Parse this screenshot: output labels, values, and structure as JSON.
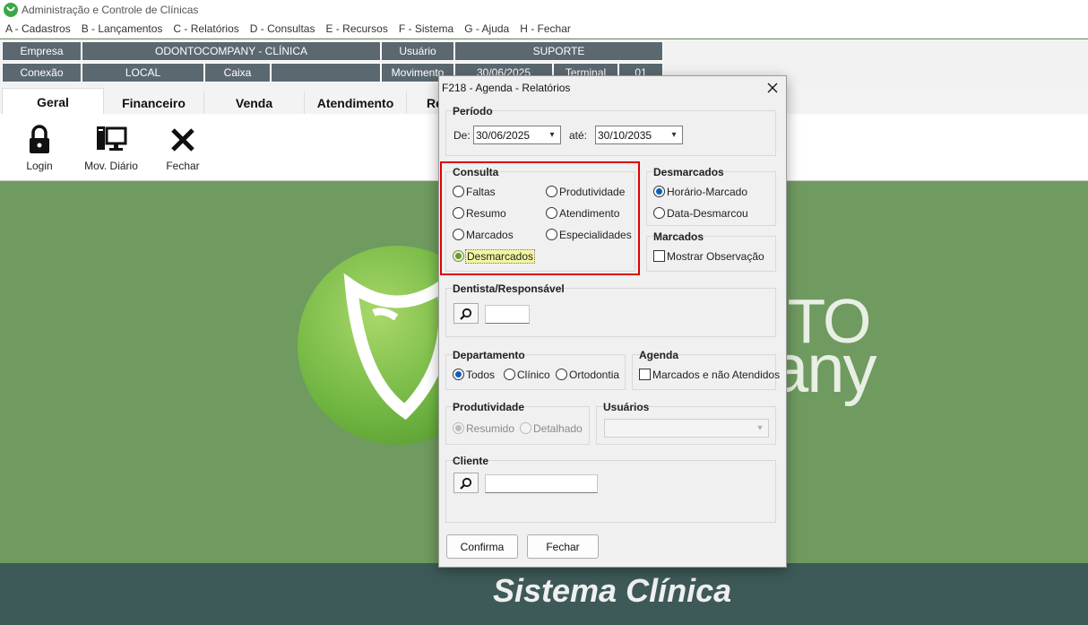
{
  "window": {
    "title": "Administração e Controle de Clínicas"
  },
  "menu": [
    "A - Cadastros",
    "B - Lançamentos",
    "C - Relatórios",
    "D - Consultas",
    "E - Recursos",
    "F - Sistema",
    "G - Ajuda",
    "H - Fechar"
  ],
  "info": {
    "empresa_label": "Empresa",
    "empresa_value": "ODONTOCOMPANY - CLÍNICA",
    "usuario_label": "Usuário",
    "usuario_value": "SUPORTE",
    "conexao_label": "Conexão",
    "conexao_value": "LOCAL",
    "caixa_label": "Caixa",
    "caixa_value": "",
    "movimento_label": "Movimento",
    "movimento_value": "30/06/2025",
    "terminal_label": "Terminal",
    "terminal_value": "01"
  },
  "tabs": [
    "Geral",
    "Financeiro",
    "Venda",
    "Atendimento",
    "Re"
  ],
  "ribbon": {
    "login": "Login",
    "mov_diario": "Mov. Diário",
    "fechar": "Fechar"
  },
  "brand": {
    "slogan": "Sistema Clínica",
    "logo_line1": "NTO",
    "logo_line2": "any"
  },
  "dialog": {
    "title": "F218 - Agenda - Relatórios",
    "periodo": {
      "label": "Período",
      "de_label": "De:",
      "de_value": "30/06/2025",
      "ate_label": "até:",
      "ate_value": "30/10/2035"
    },
    "consulta": {
      "label": "Consulta",
      "options": [
        "Faltas",
        "Produtividade",
        "Resumo",
        "Atendimento",
        "Marcados",
        "Especialidades",
        "Desmarcados"
      ],
      "selected": "Desmarcados"
    },
    "desmarcados": {
      "label": "Desmarcados",
      "options": [
        "Horário-Marcado",
        "Data-Desmarcou"
      ],
      "selected": "Horário-Marcado"
    },
    "marcados": {
      "label": "Marcados",
      "checkbox": "Mostrar Observação",
      "checked": false
    },
    "dentista": {
      "label": "Dentista/Responsável",
      "value": ""
    },
    "departamento": {
      "label": "Departamento",
      "options": [
        "Todos",
        "Clínico",
        "Ortodontia"
      ],
      "selected": "Todos"
    },
    "agenda": {
      "label": "Agenda",
      "checkbox": "Marcados e não Atendidos",
      "checked": false
    },
    "produtividade": {
      "label": "Produtividade",
      "options": [
        "Resumido",
        "Detalhado"
      ],
      "selected": "Resumido"
    },
    "usuarios": {
      "label": "Usuários",
      "value": ""
    },
    "cliente": {
      "label": "Cliente",
      "value": ""
    },
    "buttons": {
      "confirma": "Confirma",
      "fechar": "Fechar"
    }
  },
  "colors": {
    "highlight": "#e00000",
    "radio_selected": "#0a5ebf",
    "background_green": "#6f9a60",
    "bottom_band": "#3e5a58"
  }
}
